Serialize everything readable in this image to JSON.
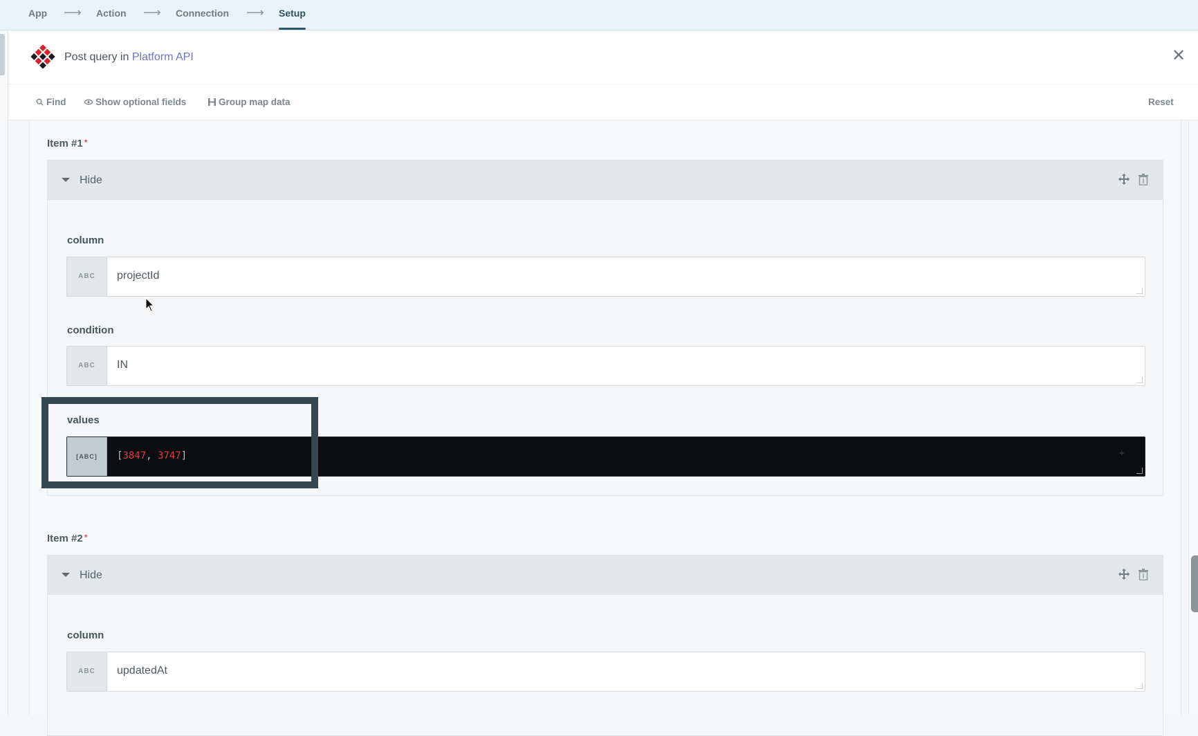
{
  "breadcrumb": {
    "steps": [
      "App",
      "Action",
      "Connection",
      "Setup"
    ],
    "active_step": "Setup"
  },
  "header": {
    "title_prefix": "Post query in",
    "app_name": "Platform API",
    "close_icon": "close-icon"
  },
  "toolbar": {
    "find_label": "Find",
    "optional_label": "Show optional fields",
    "group_label": "Group map data",
    "reset_label": "Reset"
  },
  "items": [
    {
      "label": "Item #1",
      "required_mark": "*",
      "toggle_label": "Hide",
      "fields": [
        {
          "label": "column",
          "type": "ABC",
          "value": "projectId"
        },
        {
          "label": "condition",
          "type": "ABC",
          "value": "IN"
        },
        {
          "label": "values",
          "type": "[ABC]",
          "value_open": "[",
          "num1": "3847",
          "sep": ", ",
          "num2": "3747",
          "value_close": "]"
        }
      ]
    },
    {
      "label": "Item #2",
      "required_mark": "*",
      "toggle_label": "Hide",
      "fields": [
        {
          "label": "column",
          "type": "ABC",
          "value": "updatedAt"
        }
      ]
    }
  ],
  "colors": {
    "accent": "#2f5968",
    "link": "#6f73c9",
    "highlight_border": "#37474f",
    "array_number": "#e33a48"
  }
}
